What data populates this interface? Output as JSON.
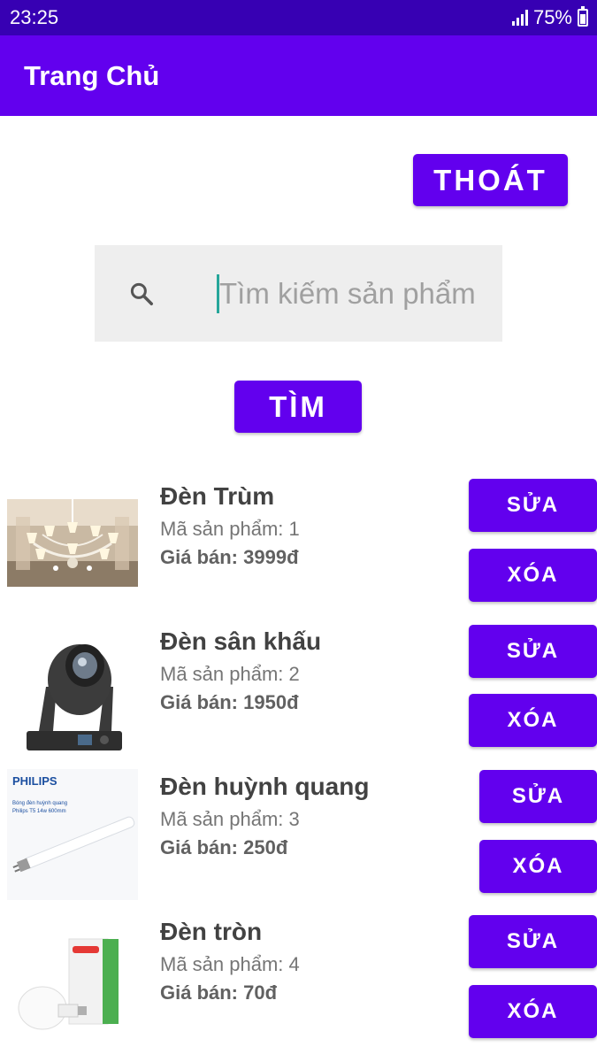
{
  "status_bar": {
    "time": "23:25",
    "battery": "75%"
  },
  "app_bar": {
    "title": "Trang Chủ"
  },
  "logout_label": "THOÁT",
  "search": {
    "placeholder": "Tìm kiếm sản phẩm",
    "value": "",
    "button_label": "TÌM"
  },
  "products": [
    {
      "name": "Đèn Trùm",
      "code": "Mã sản phẩm: 1",
      "price": "Giá bán: 3999đ",
      "edit_label": "SỬA",
      "delete_label": "XÓA"
    },
    {
      "name": "Đèn sân khấu",
      "code": "Mã sản phẩm: 2",
      "price": "Giá bán: 1950đ",
      "edit_label": "SỬA",
      "delete_label": "XÓA"
    },
    {
      "name": "Đèn huỳnh quang",
      "code": "Mã sản phẩm: 3",
      "price": "Giá bán: 250đ",
      "edit_label": "SỬA",
      "delete_label": "XÓA"
    },
    {
      "name": "Đèn tròn",
      "code": "Mã sản phẩm: 4",
      "price": "Giá bán: 70đ",
      "edit_label": "SỬA",
      "delete_label": "XÓA"
    }
  ],
  "images": {
    "philips_brand": "PHILIPS",
    "philips_caption": "Bóng đèn huỳnh quang Philips T5 14w 600mm"
  },
  "colors": {
    "primary": "#6200EE",
    "primary_dark": "#3700B3",
    "search_bg": "#EEEEEE",
    "cursor": "#26A69A"
  }
}
